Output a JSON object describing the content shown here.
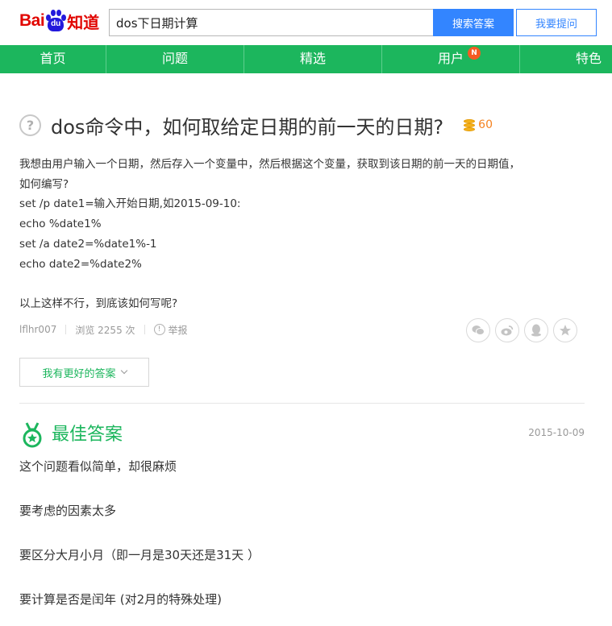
{
  "header": {
    "logo_bai": "Bai",
    "logo_du": "du",
    "logo_zhidao": "知道",
    "search_value": "dos下日期计算",
    "search_button": "搜索答案",
    "ask_button": "我要提问"
  },
  "nav": {
    "items": [
      {
        "label": "首页"
      },
      {
        "label": "问题"
      },
      {
        "label": "精选"
      },
      {
        "label": "用户",
        "badge": "N"
      },
      {
        "label": "特色"
      }
    ]
  },
  "question": {
    "title": "dos命令中，如何取给定日期的前一天的日期?",
    "reward": "60",
    "body_lines": [
      "我想由用户输入一个日期，然后存入一个变量中，然后根据这个变量，获取到该日期的前一天的日期值，",
      "如何编写?",
      "set /p date1=输入开始日期,如2015-09-10:",
      "echo %date1%",
      "set /a date2=%date1%-1",
      "echo date2=%date2%",
      "",
      "以上这样不行，到底该如何写呢?"
    ],
    "author": "lflhr007",
    "views": "浏览 2255 次",
    "report": "举报"
  },
  "better_answer_button": "我有更好的答案",
  "best_answer": {
    "title": "最佳答案",
    "date": "2015-10-09",
    "paragraphs": [
      "这个问题看似简单，却很麻烦",
      "要考虑的因素太多",
      "要区分大月小月（即一月是30天还是31天 ）",
      "要计算是否是闰年 (对2月的特殊处理)"
    ]
  },
  "colors": {
    "brand_green": "#1cb65d",
    "brand_blue": "#3385ff",
    "logo_red": "#e10601",
    "reward_orange": "#f5821f"
  }
}
